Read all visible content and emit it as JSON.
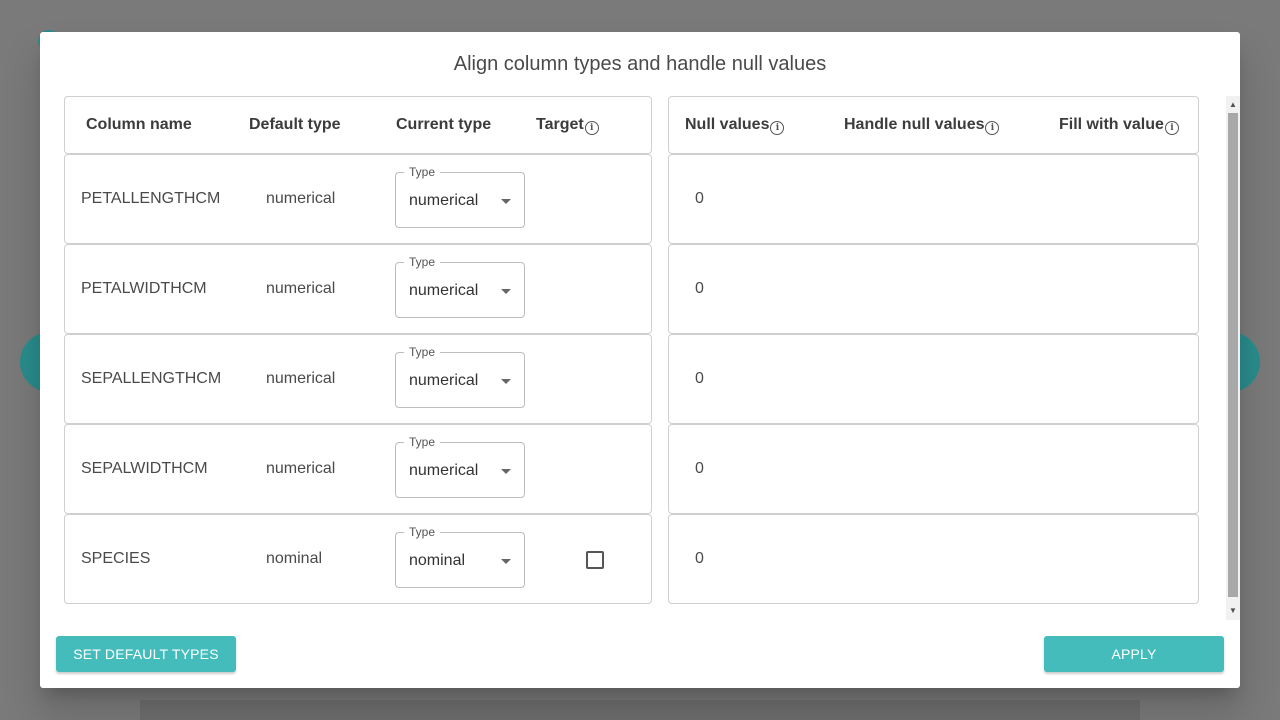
{
  "dialog": {
    "title": "Align column types and handle null values",
    "set_default_label": "SET DEFAULT TYPES",
    "apply_label": "APPLY"
  },
  "headers": {
    "column_name": "Column name",
    "default_type": "Default type",
    "current_type": "Current type",
    "target": "Target",
    "null_values": "Null values",
    "handle_null": "Handle null values",
    "fill_with": "Fill with value",
    "info_glyph": "i"
  },
  "select_legend": "Type",
  "rows": [
    {
      "name": "PETALLENGTHCM",
      "default_type": "numerical",
      "current_type": "numerical",
      "null_values": "0",
      "target_checkbox": false
    },
    {
      "name": "PETALWIDTHCM",
      "default_type": "numerical",
      "current_type": "numerical",
      "null_values": "0",
      "target_checkbox": false
    },
    {
      "name": "SEPALLENGTHCM",
      "default_type": "numerical",
      "current_type": "numerical",
      "null_values": "0",
      "target_checkbox": false
    },
    {
      "name": "SEPALWIDTHCM",
      "default_type": "numerical",
      "current_type": "numerical",
      "null_values": "0",
      "target_checkbox": false
    },
    {
      "name": "SPECIES",
      "default_type": "nominal",
      "current_type": "nominal",
      "null_values": "0",
      "target_checkbox": true,
      "target_checked": false
    }
  ],
  "colors": {
    "accent": "#44bcbc",
    "overlay": "#7a7a7a"
  }
}
